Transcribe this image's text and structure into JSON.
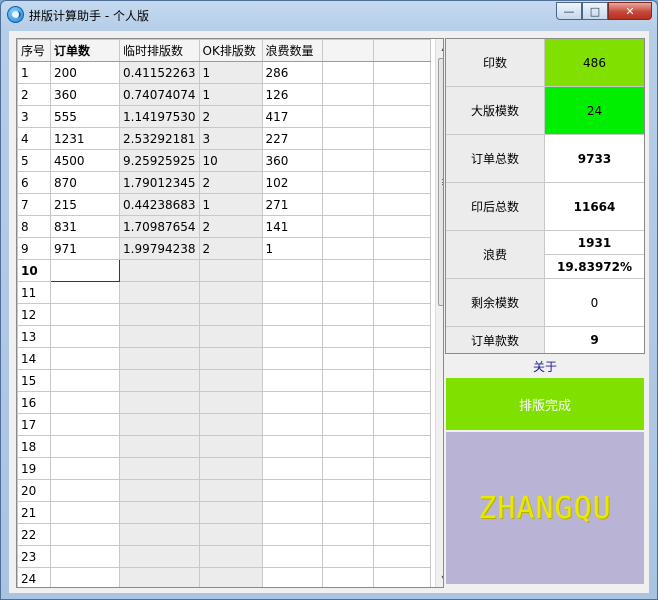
{
  "window": {
    "title": "拼版计算助手 - 个人版",
    "minimize": "—",
    "maximize": "□",
    "close": "✕"
  },
  "grid": {
    "headers": [
      "序号",
      "订单数",
      "临时排版数",
      "OK排版数",
      "浪费数量",
      "",
      ""
    ],
    "rows": [
      [
        "1",
        "200",
        "0.41152263",
        "1",
        "286"
      ],
      [
        "2",
        "360",
        "0.74074074",
        "1",
        "126"
      ],
      [
        "3",
        "555",
        "1.14197530",
        "2",
        "417"
      ],
      [
        "4",
        "1231",
        "2.53292181",
        "3",
        "227"
      ],
      [
        "5",
        "4500",
        "9.25925925",
        "10",
        "360"
      ],
      [
        "6",
        "870",
        "1.79012345",
        "2",
        "102"
      ],
      [
        "7",
        "215",
        "0.44238683",
        "1",
        "271"
      ],
      [
        "8",
        "831",
        "1.70987654",
        "2",
        "141"
      ],
      [
        "9",
        "971",
        "1.99794238",
        "2",
        "1"
      ],
      [
        "10",
        "",
        "",
        "",
        ""
      ],
      [
        "11",
        "",
        "",
        "",
        ""
      ],
      [
        "12",
        "",
        "",
        "",
        ""
      ],
      [
        "13",
        "",
        "",
        "",
        ""
      ],
      [
        "14",
        "",
        "",
        "",
        ""
      ],
      [
        "15",
        "",
        "",
        "",
        ""
      ],
      [
        "16",
        "",
        "",
        "",
        ""
      ],
      [
        "17",
        "",
        "",
        "",
        ""
      ],
      [
        "18",
        "",
        "",
        "",
        ""
      ],
      [
        "19",
        "",
        "",
        "",
        ""
      ],
      [
        "20",
        "",
        "",
        "",
        ""
      ],
      [
        "21",
        "",
        "",
        "",
        ""
      ],
      [
        "22",
        "",
        "",
        "",
        ""
      ],
      [
        "23",
        "",
        "",
        "",
        ""
      ],
      [
        "24",
        "",
        "",
        "",
        ""
      ]
    ],
    "current_row": 9,
    "scroll_up": "▲",
    "scroll_down": "▼"
  },
  "stats": {
    "print_count": {
      "label": "印数",
      "value": "486",
      "color": "#80e000"
    },
    "big_plate": {
      "label": "大版模数",
      "value": "24",
      "color": "#00ee00"
    },
    "order_total": {
      "label": "订单总数",
      "value": "9733"
    },
    "after_print_total": {
      "label": "印后总数",
      "value": "11664"
    },
    "waste": {
      "label": "浪费",
      "value": "1931",
      "percent": "19.83972%"
    },
    "remaining": {
      "label": "剩余模数",
      "value": "0"
    },
    "order_count": {
      "label": "订单款数",
      "value": "9"
    }
  },
  "about": "关于",
  "done_button": {
    "label": "排版完成",
    "color": "#80e000"
  },
  "logo": {
    "text": "ZHANGQU",
    "background": "#b9b3d6",
    "color": "#e8e800"
  }
}
